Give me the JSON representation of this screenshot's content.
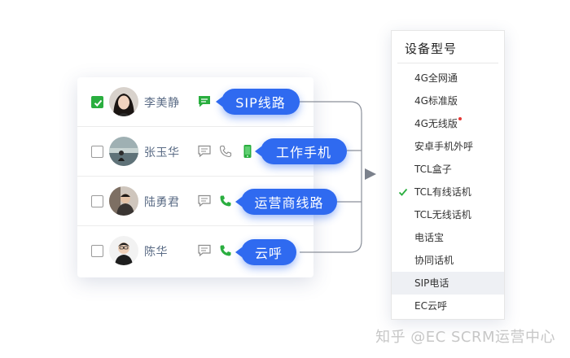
{
  "contacts": [
    {
      "name": "李美静",
      "checked": true,
      "channel": "sip"
    },
    {
      "name": "张玉华",
      "checked": false,
      "channel": "mobile"
    },
    {
      "name": "陆勇君",
      "checked": false,
      "channel": "carrier"
    },
    {
      "name": "陈华",
      "checked": false,
      "channel": "cloud"
    }
  ],
  "callouts": {
    "sip": "SIP线路",
    "mobile": "工作手机",
    "carrier": "运营商线路",
    "cloud": "云呼"
  },
  "dropdown": {
    "title": "设备型号",
    "items": [
      {
        "label": "4G全网通"
      },
      {
        "label": "4G标准版"
      },
      {
        "label": "4G无线版",
        "new_dot": true
      },
      {
        "label": "安卓手机外呼"
      },
      {
        "label": "TCL盒子"
      },
      {
        "label": "TCL有线话机",
        "selected": true
      },
      {
        "label": "TCL无线话机"
      },
      {
        "label": "电话宝"
      },
      {
        "label": "协同话机"
      },
      {
        "label": "SIP电话",
        "highlighted": true
      },
      {
        "label": "EC云呼"
      }
    ]
  },
  "colors": {
    "accent_blue": "#2f6af0",
    "active_green": "#2aae3f",
    "inactive_gray": "#8c8c8c"
  },
  "watermark": "知乎 @EC SCRM运营中心"
}
